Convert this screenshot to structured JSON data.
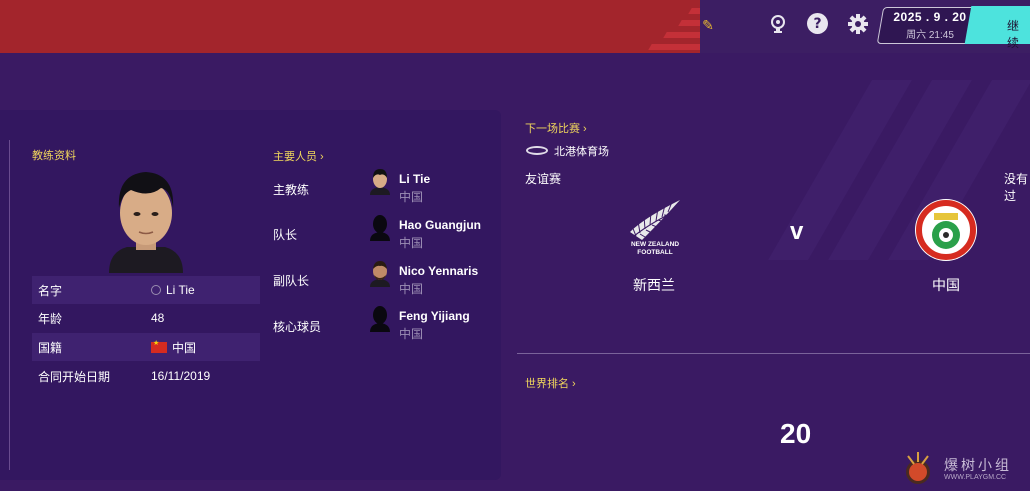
{
  "topbar": {
    "date": "2025 . 9 . 20",
    "weekday_time": "周六 21:45",
    "continue_label": "继续"
  },
  "coach": {
    "section_title": "教练资料",
    "rows": [
      {
        "key": "名字",
        "value": "Li Tie"
      },
      {
        "key": "年龄",
        "value": "48"
      },
      {
        "key": "国籍",
        "value": "中国"
      },
      {
        "key": "合同开始日期",
        "value": "16/11/2019"
      }
    ]
  },
  "key_people": {
    "section_title": "主要人员",
    "items": [
      {
        "role": "主教练",
        "name": "Li Tie",
        "nation": "中国"
      },
      {
        "role": "队长",
        "name": "Hao Guangjun",
        "nation": "中国"
      },
      {
        "role": "副队长",
        "name": "Nico Yennaris",
        "nation": "中国"
      },
      {
        "role": "核心球员",
        "name": "Feng Yijiang",
        "nation": "中国"
      }
    ]
  },
  "next_match": {
    "section_title": "下一场比赛",
    "stadium": "北港体育场",
    "competition": "友谊赛",
    "right_note": "没有过",
    "vs": "v",
    "home_team": "新西兰",
    "away_team": "中国",
    "home_crest_text": "NEW ZEALAND FOOTBALL"
  },
  "world_ranking": {
    "section_title": "世界排名",
    "value": "20"
  },
  "watermark": {
    "text": "爆树小组",
    "sub": "WWW.PLAYGM.CC"
  },
  "colors": {
    "topbar": "#a3252c",
    "background": "#3a1a63",
    "accent_yellow": "#f0d65c",
    "continue_button": "#4de3dd"
  }
}
